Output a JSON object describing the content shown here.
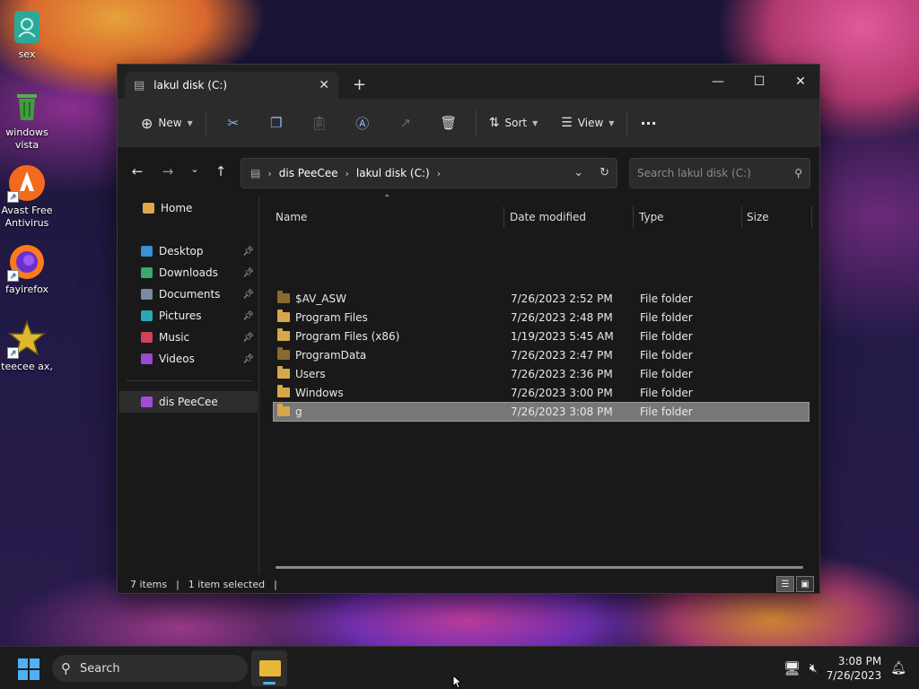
{
  "desktop": {
    "icons": [
      {
        "label": "sex",
        "icon": "user-folder-icon"
      },
      {
        "label": "windows vista",
        "icon": "recycle-bin-icon"
      },
      {
        "label": "Avast Free Antivirus",
        "icon": "avast-icon"
      },
      {
        "label": "fayirefox",
        "icon": "firefox-icon"
      },
      {
        "label": "teecee ax,",
        "icon": "star-icon"
      }
    ]
  },
  "window": {
    "tab_title": "lakul disk (C:)",
    "new_tab": "+",
    "controls": {
      "minimize": "—",
      "maximize": "☐",
      "close": "✕"
    }
  },
  "toolbar": {
    "new_label": "New",
    "sort_label": "Sort",
    "view_label": "View",
    "more_label": "···"
  },
  "address": {
    "crumbs": [
      "dis PeeCee",
      "lakul disk (C:)"
    ],
    "search_placeholder": "Search lakul disk (C:)"
  },
  "sidebar": {
    "home": "Home",
    "quick": [
      {
        "label": "Desktop",
        "color": "#3a8fd6"
      },
      {
        "label": "Downloads",
        "color": "#3aa76d"
      },
      {
        "label": "Documents",
        "color": "#7a8aa0"
      },
      {
        "label": "Pictures",
        "color": "#2aa6b8"
      },
      {
        "label": "Music",
        "color": "#d0445a"
      },
      {
        "label": "Videos",
        "color": "#9a4ad0"
      }
    ],
    "this_pc": "dis PeeCee"
  },
  "columns": {
    "name": "Name",
    "date": "Date modified",
    "type": "Type",
    "size": "Size"
  },
  "files": [
    {
      "name": "$AV_ASW",
      "date": "7/26/2023 2:52 PM",
      "type": "File folder"
    },
    {
      "name": "Program Files",
      "date": "7/26/2023 2:48 PM",
      "type": "File folder"
    },
    {
      "name": "Program Files (x86)",
      "date": "1/19/2023 5:45 AM",
      "type": "File folder"
    },
    {
      "name": "ProgramData",
      "date": "7/26/2023 2:47 PM",
      "type": "File folder"
    },
    {
      "name": "Users",
      "date": "7/26/2023 2:36 PM",
      "type": "File folder"
    },
    {
      "name": "Windows",
      "date": "7/26/2023 3:00 PM",
      "type": "File folder"
    },
    {
      "name": "g",
      "date": "7/26/2023 3:08 PM",
      "type": "File folder"
    }
  ],
  "status": {
    "count": "7 items",
    "selected": "1 item selected"
  },
  "taskbar": {
    "search_label": "Search",
    "time": "3:08 PM",
    "date": "7/26/2023"
  },
  "colors": {
    "accent": "#4fb1f2",
    "folder": "#d7a84a",
    "selected_row": "#777777"
  }
}
